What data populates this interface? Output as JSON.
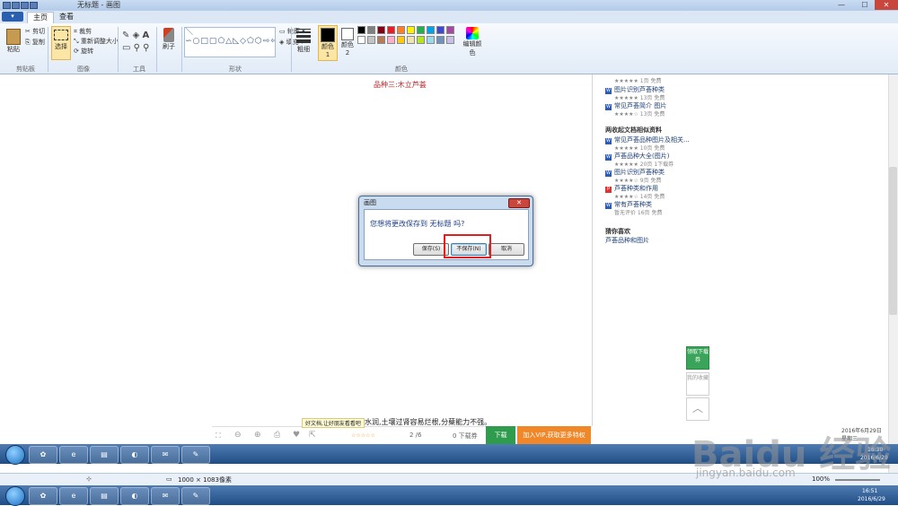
{
  "window": {
    "title": "无标题 - 画图",
    "minimize": "—",
    "maximize": "☐",
    "close": "✕"
  },
  "tabs": {
    "file": "▾",
    "home": "主页",
    "view": "查看"
  },
  "ribbon": {
    "paste_label": "粘贴",
    "cut_label": "剪切",
    "copy_label": "复制",
    "clipboard_group": "剪贴板",
    "select_label": "选择",
    "crop_label": "裁剪",
    "resize_label": "重新调整大小",
    "rotate_label": "旋转",
    "image_group": "图像",
    "tools_group": "工具",
    "brushes_label": "刷子",
    "shapes_group": "形状",
    "outline_label": "轮廓",
    "fill_label": "填充",
    "size_label": "粗细",
    "color1_label": "颜色 1",
    "color2_label": "颜色 2",
    "edit_colors_label": "编辑颜色",
    "colors_group": "颜色",
    "palette_colors": [
      "#000000",
      "#7f7f7f",
      "#880015",
      "#ed1c24",
      "#ff7f27",
      "#fff200",
      "#22b14c",
      "#00a2e8",
      "#3f48cc",
      "#a349a4",
      "#ffffff",
      "#c3c3c3",
      "#b97a57",
      "#ffaec9",
      "#ffc90e",
      "#efe4b0",
      "#b5e61d",
      "#99d9ea",
      "#7092be",
      "#c8bfe7"
    ]
  },
  "document": {
    "heading": "品种三:木立芦荟",
    "body_text": "水润,土壤过肾容易烂根,分蘖能力不强。",
    "tooltip": "好文档,让好朋友看看吧",
    "pager": "2 /6",
    "score_text": "0 下载券",
    "download_label": "下载",
    "vip_label": "加入VIP,获取更多特权"
  },
  "sidebar": {
    "items_top": [
      {
        "meta": "★★★★★ 1页 免费"
      },
      {
        "title": "图片识别芦荟种类",
        "meta": "★★★★★ 13页 免费"
      },
      {
        "title": "常见芦荟简介 图片",
        "meta": "★★★★☆ 13页 免费"
      }
    ],
    "related_heading": "两收起文档相似资料",
    "related": [
      {
        "title": "常见芦荟品种图片及相关...",
        "meta": "★★★★★ 10页 免费",
        "icon": "W"
      },
      {
        "title": "芦荟品种大全(图片)",
        "meta": "★★★★★ 20页 1下载券",
        "icon": "W"
      },
      {
        "title": "图片识别芦荟种类",
        "meta": "★★★★☆ 9页 免费",
        "icon": "W"
      },
      {
        "title": "芦荟种类和作用",
        "meta": "★★★★☆ 14页 免费",
        "icon": "P"
      },
      {
        "title": "常有芦荟种类",
        "meta": "暂无评价 16页 免费",
        "icon": "W"
      }
    ],
    "guess_heading": "猜你喜欢",
    "guess_link": "芦荟品种和图片",
    "float_download": "领取下载券",
    "float_share": "我的收藏"
  },
  "dialog": {
    "title": "画图",
    "close": "✕",
    "message": "您想将更改保存到 无标题 吗?",
    "save_label": "保存(S)",
    "dont_save_label": "不保存(N)",
    "cancel_label": "取消"
  },
  "taskbar_inner": {
    "clock_time": "16:30",
    "clock_date": "2016/6/29",
    "date_banner": "2016年6月29日",
    "weekday": "星期三"
  },
  "status": {
    "dimensions": "1000 × 1083像素",
    "zoom": "100%"
  },
  "taskbar_outer": {
    "clock_time": "16:51",
    "clock_date": "2016/6/29"
  },
  "watermark": {
    "brand": "Baidu 经验",
    "url": "jingyan.baidu.com"
  }
}
